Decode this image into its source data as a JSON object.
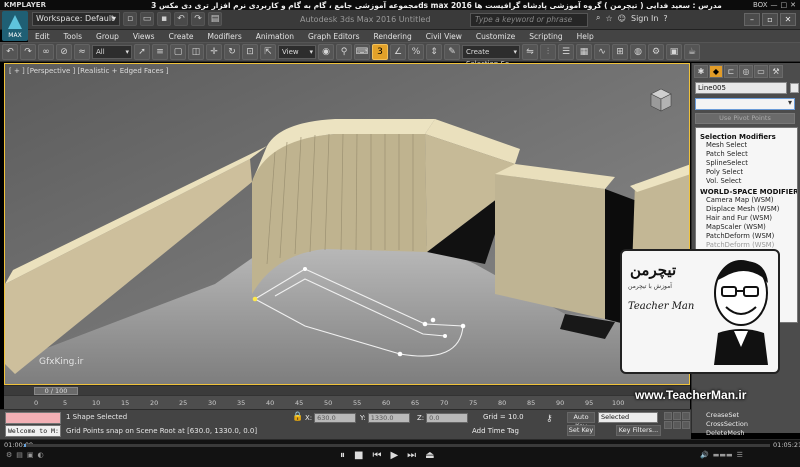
{
  "player": {
    "name": "KMPLAYER",
    "course_title": "مجموعه آموزشی جامع ، گام به گام و کاربردی نرم افزار تری دی مکس 3ds max 2016  مدرس : سعید فدایی ( تیچرمن ) گروه آموزشی پادشاه گرافیست ها",
    "box_label": "BOX",
    "time_current": "01:00:09",
    "time_total": "01:05:21"
  },
  "titlebar": {
    "logo_text": "MAX",
    "workspace": "Workspace: Default",
    "doc_title": "Autodesk 3ds Max 2016    Untitled",
    "search_placeholder": "Type a keyword or phrase",
    "sign_in": "Sign In"
  },
  "menu": [
    "Edit",
    "Tools",
    "Group",
    "Views",
    "Create",
    "Modifiers",
    "Animation",
    "Graph Editors",
    "Rendering",
    "Civil View",
    "Customize",
    "Scripting",
    "Help"
  ],
  "toolbar": {
    "filter": "All",
    "ref_coord": "View",
    "snap_label": "3",
    "selection_set": "Create Selection Se"
  },
  "viewport": {
    "label": "[ + ] [Perspective ] [Realistic + Edged Faces ]",
    "accent": "#f0c23a"
  },
  "command_panel": {
    "object_name": "Line005",
    "use_pivot": "Use Pivot Points",
    "sections": [
      {
        "title": "Selection Modifiers",
        "items": [
          {
            "label": "Mesh Select",
            "dim": false
          },
          {
            "label": "Patch Select",
            "dim": false
          },
          {
            "label": "SplineSelect",
            "dim": false
          },
          {
            "label": "Poly Select",
            "dim": false
          },
          {
            "label": "Vol. Select",
            "dim": false
          }
        ]
      },
      {
        "title": "WORLD-SPACE MODIFIERS",
        "items": [
          {
            "label": "Camera Map (WSM)",
            "dim": false
          },
          {
            "label": "Displace Mesh (WSM)",
            "dim": false
          },
          {
            "label": "Hair and Fur (WSM)",
            "dim": false
          },
          {
            "label": "MapScaler (WSM)",
            "dim": false
          },
          {
            "label": "PatchDeform (WSM)",
            "dim": false
          },
          {
            "label": "PatchDeform (WSM)",
            "dim": true
          },
          {
            "label": "hape (WSM)",
            "dim": true
          }
        ]
      }
    ],
    "bottom_items": [
      "CreaseSet",
      "CrossSection",
      "DeleteMesh"
    ]
  },
  "branding": {
    "brand_fa": "تیچرمن",
    "sub_fa": "آموزش با تیچرمن",
    "brand_en": "Teacher Man",
    "url": "www.TeacherMan.ir",
    "watermark_site": "GfxKing.ir"
  },
  "timeline": {
    "frame": "0 / 100",
    "ticks": [
      "0",
      "5",
      "10",
      "15",
      "20",
      "25",
      "30",
      "35",
      "40",
      "45",
      "50",
      "55",
      "60",
      "65",
      "70",
      "75",
      "80",
      "85",
      "90",
      "95",
      "100"
    ]
  },
  "status": {
    "welcome": "Welcome to M:",
    "selection": "1 Shape Selected",
    "prompt": "Grid Points snap on Scene Root at [630.0, 1330.0, 0.0]",
    "x_label": "X:",
    "x": "630.0",
    "y_label": "Y:",
    "y": "1330.0",
    "z_label": "Z:",
    "z": "0.0",
    "grid": "Grid = 10.0",
    "auto_key": "Auto Key",
    "set_key": "Set Key",
    "selected": "Selected",
    "key_filters": "Key Filters...",
    "add_time_tag": "Add Time Tag"
  }
}
